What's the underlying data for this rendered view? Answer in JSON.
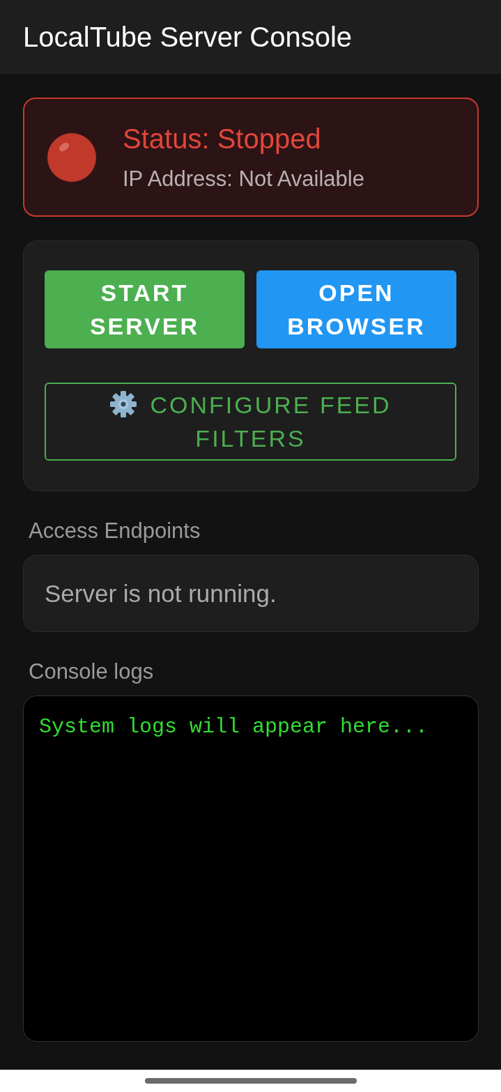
{
  "app_bar": {
    "title": "LocalTube Server Console"
  },
  "status": {
    "running": false,
    "title": "Status: Stopped",
    "ip_address": "IP Address: Not Available"
  },
  "actions": [
    {
      "label": "START SERVER",
      "kind": "filled",
      "color": "#4caf50",
      "icon": false
    },
    {
      "label": "OPEN BROWSER",
      "kind": "filled",
      "color": "#2196f3",
      "icon": false
    },
    {
      "label": "CONFIGURE FEED FILTERS",
      "kind": "outlined",
      "color": "#4caf50",
      "icon": true
    }
  ],
  "endpoints": {
    "label": "Access Endpoints",
    "message": "Server is not running."
  },
  "console": {
    "label": "Console logs",
    "lines": [
      "System logs will appear here..."
    ]
  }
}
